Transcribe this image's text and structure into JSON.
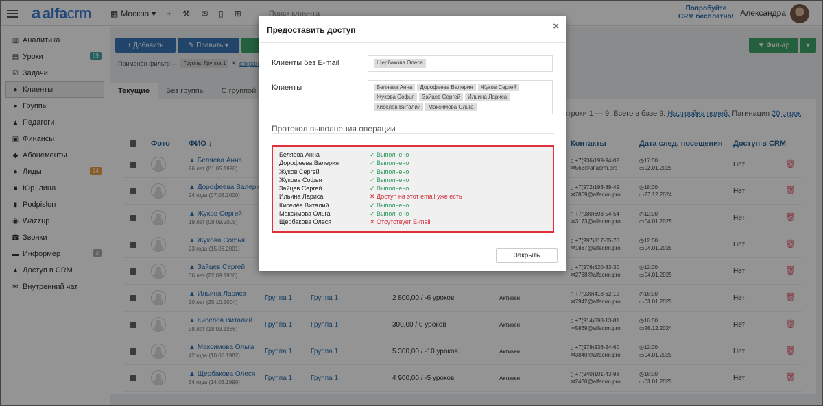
{
  "topbar": {
    "logo_mark": "a",
    "logo_text": "alfa",
    "logo_crm": "crm",
    "branch": "Москва",
    "search_placeholder": "Поиск клиента",
    "try_line1": "Попробуйте",
    "try_line2": "CRM бесплатно!",
    "user_name": "Александра"
  },
  "sidebar": {
    "items": [
      {
        "icon": "chart-icon",
        "glyph": "▥",
        "label": "Аналитика"
      },
      {
        "icon": "lessons-icon",
        "glyph": "▤",
        "label": "Уроки",
        "badge": "59",
        "badge_color": "#3ea5a0"
      },
      {
        "icon": "tasks-icon",
        "glyph": "☑",
        "label": "Задачи"
      },
      {
        "icon": "clients-icon",
        "glyph": "●",
        "label": "Клиенты",
        "active": true
      },
      {
        "icon": "groups-icon",
        "glyph": "●",
        "label": "Группы"
      },
      {
        "icon": "teachers-icon",
        "glyph": "▲",
        "label": "Педагоги"
      },
      {
        "icon": "finance-icon",
        "glyph": "▣",
        "label": "Финансы"
      },
      {
        "icon": "subscriptions-icon",
        "glyph": "◆",
        "label": "Абонементы"
      },
      {
        "icon": "leads-icon",
        "glyph": "●",
        "label": "Лиды",
        "badge": "24",
        "badge_color": "#e8a040"
      },
      {
        "icon": "legal-icon",
        "glyph": "■",
        "label": "Юр. лица"
      },
      {
        "icon": "podpislon-icon",
        "glyph": "▮",
        "label": "Podpislon"
      },
      {
        "icon": "wazzup-icon",
        "glyph": "◉",
        "label": "Wazzup"
      },
      {
        "icon": "calls-icon",
        "glyph": "☎",
        "label": "Звонки"
      },
      {
        "icon": "informer-icon",
        "glyph": "▬",
        "label": "Информер",
        "badge": "3",
        "badge_color": "#aaa"
      },
      {
        "icon": "lock-icon",
        "glyph": "▲",
        "label": "Доступ в CRM"
      },
      {
        "icon": "chat-icon",
        "glyph": "✉",
        "label": "Внутренний чат"
      }
    ]
  },
  "toolbar": {
    "add_label": "+ Добавить",
    "edit_label": "✎ Править ▾",
    "filter_label": "▼ Фильтр",
    "applied_filter_label": "Применён фильтр —",
    "applied_filter_chip": "Группа: Группа 1",
    "save_link": "сохран"
  },
  "tabs": [
    "Текущие",
    "Без группы",
    "С группой"
  ],
  "table_info": {
    "text": "ены строки 1 — 9. Всего в базе 9.",
    "settings_link": "Настройка полей.",
    "pagination_label": "Пагинация",
    "pagination_link": "20 строк"
  },
  "table": {
    "headers": {
      "photo": "Фото",
      "fio": "ФИО ↓",
      "contacts": "Контакты",
      "next_visit": "Дата след. посещения",
      "crm_access": "Доступ в CRM"
    },
    "rows": [
      {
        "name": "Беляева Анна",
        "age": "26 лет (01.05.1998)",
        "group1": "",
        "group2": "",
        "balance": "",
        "status": "",
        "phone": "+7(936)199-94-02",
        "email": "563@alfacrm.pro",
        "time": "17:00",
        "date": "02.01.2025",
        "access": "Нет"
      },
      {
        "name": "Дорофеева Валерия",
        "age": "24 года (07.08.2000)",
        "group1": "",
        "group2": "",
        "balance": "",
        "status": "",
        "phone": "+7(972)193-89-49",
        "email": "7809@alfacrm.pro",
        "time": "18:00",
        "date": "27.12.2024",
        "access": "Нет"
      },
      {
        "name": "Жуков Сергей",
        "age": "19 лет (08.09.2005)",
        "group1": "",
        "group2": "",
        "balance": "",
        "status": "",
        "phone": "+7(980)693-54-54",
        "email": "3173@alfacrm.pro",
        "time": "12:00",
        "date": "04.01.2025",
        "access": "Нет"
      },
      {
        "name": "Жукова Софья",
        "age": "23 года (15.06.2001)",
        "group1": "",
        "group2": "",
        "balance": "",
        "status": "",
        "phone": "+7(997)817-05-70",
        "email": "1887@alfacrm.pro",
        "time": "12:00",
        "date": "04.01.2025",
        "access": "Нет"
      },
      {
        "name": "Зайцев Сергей",
        "age": "36 лет (22.09.1988)",
        "group1": "",
        "group2": "",
        "balance": "",
        "status": "",
        "phone": "+7(976)520-83-30",
        "email": "2768@alfacrm.pro",
        "time": "12:00",
        "date": "04.01.2025",
        "access": "Нет"
      },
      {
        "name": "Ильина Лариса",
        "age": "20 лет (25.10.2004)",
        "group1": "Группа 1",
        "group2": "Группа 1",
        "balance": "2 800,00 / -6 уроков",
        "status": "Активен",
        "phone": "+7(930)413-62-12",
        "email": "7942@alfacrm.pro",
        "time": "16:00",
        "date": "03.01.2025",
        "access": "Нет"
      },
      {
        "name": "Киселёв Виталий",
        "age": "38 лет (18.03.1986)",
        "group1": "Группа 1",
        "group2": "Группа 1",
        "balance": "300,00 / 0 уроков",
        "status": "Активен",
        "phone": "+7(914)698-13-81",
        "email": "5869@alfacrm.pro",
        "time": "16:00",
        "date": "26.12.2024",
        "access": "Нет"
      },
      {
        "name": "Максимова Ольга",
        "age": "42 года (10.08.1982)",
        "group1": "Группа 1",
        "group2": "Группа 1",
        "balance": "5 300,00 / -10 уроков",
        "status": "Активен",
        "phone": "+7(979)936-24-60",
        "email": "3840@alfacrm.pro",
        "time": "12:00",
        "date": "04.01.2025",
        "access": "Нет"
      },
      {
        "name": "Щербакова Олеся",
        "age": "34 года (14.03.1990)",
        "group1": "Группа 1",
        "group2": "Группа 1",
        "balance": "4 900,00 / -5 уроков",
        "status": "Активен",
        "phone": "+7(940)101-43-98",
        "email": "2430@alfacrm.pro",
        "time": "16:00",
        "date": "03.01.2025",
        "access": "Нет"
      }
    ]
  },
  "modal": {
    "title": "Предоставить доступ",
    "close_glyph": "×",
    "no_email_label": "Клиенты без E-mail",
    "no_email_tags": [
      "Щербакова Олеся"
    ],
    "clients_label": "Клиенты",
    "clients_tags": [
      "Беляева Анна",
      "Дорофеева Валерия",
      "Жуков Сергей",
      "Жукова Софья",
      "Зайцев Сергей",
      "Ильина Лариса",
      "Киселёв Виталий",
      "Максимова Ольга"
    ],
    "protocol_heading": "Протокол выполнения операции",
    "log": [
      {
        "name": "Беляева Анна",
        "status": "Выполнено",
        "ok": true
      },
      {
        "name": "Дорофеева Валерия",
        "status": "Выполнено",
        "ok": true
      },
      {
        "name": "Жуков Сергей",
        "status": "Выполнено",
        "ok": true
      },
      {
        "name": "Жукова Софья",
        "status": "Выполнено",
        "ok": true
      },
      {
        "name": "Зайцев Сергей",
        "status": "Выполнено",
        "ok": true
      },
      {
        "name": "Ильина Лариса",
        "status": "Доступ на этот email уже есть",
        "ok": false
      },
      {
        "name": "Киселёв Виталий",
        "status": "Выполнено",
        "ok": true
      },
      {
        "name": "Максимова Ольга",
        "status": "Выполнено",
        "ok": true
      },
      {
        "name": "Щербакова Олеся",
        "status": "Отсутствует E-mail",
        "ok": false
      }
    ],
    "close_button": "Закрыть"
  },
  "colors": {
    "accent": "#2a6fb0",
    "ok": "#2a9a5a",
    "error": "#d0303a",
    "highlight_border": "#e0303a"
  }
}
